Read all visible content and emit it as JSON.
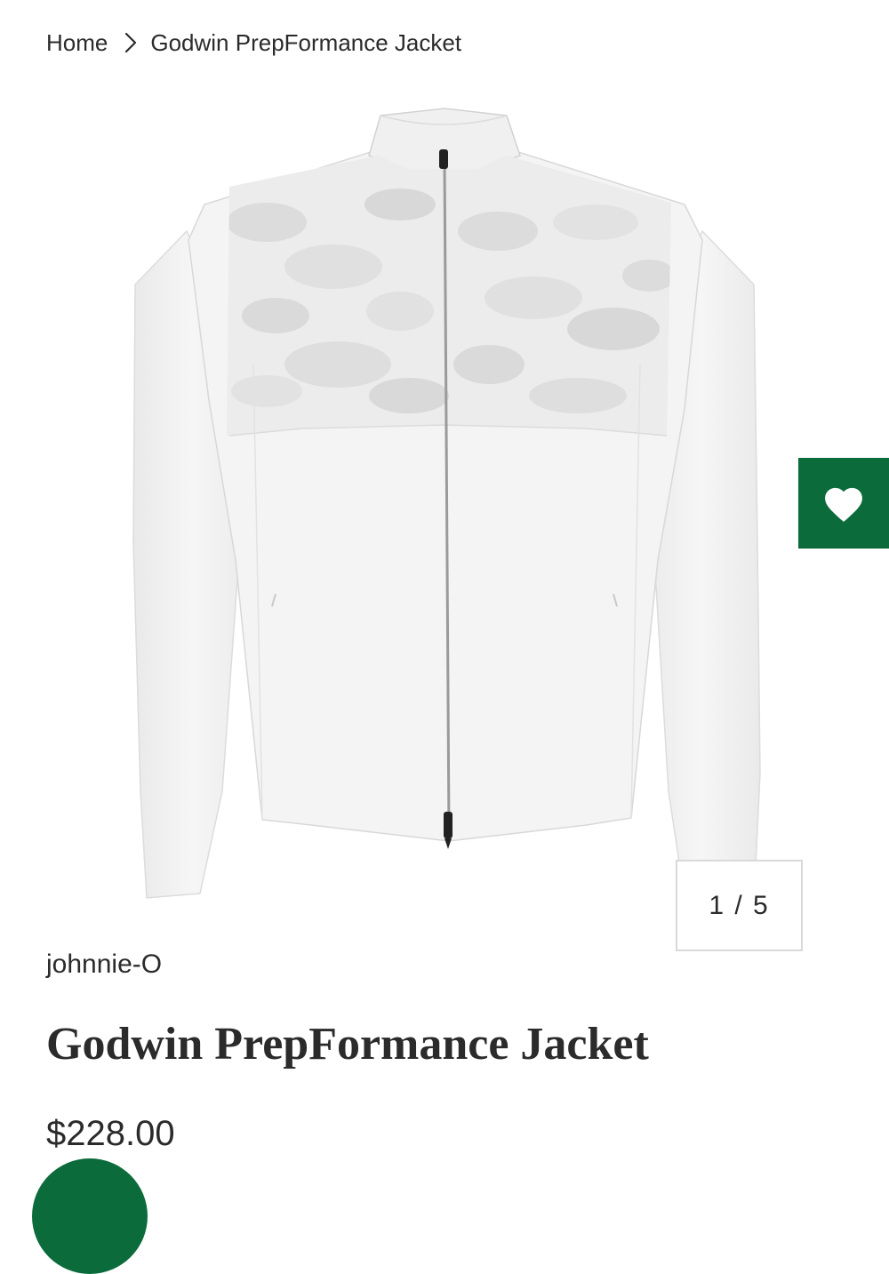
{
  "breadcrumb": {
    "home": "Home",
    "current": "Godwin PrepFormance Jacket"
  },
  "icons": {
    "separator": "chevron-right-icon",
    "wishlist": "heart-icon"
  },
  "gallery": {
    "counter": "1 / 5",
    "current_image": 1,
    "total_images": 5
  },
  "product": {
    "brand": "johnnie-O",
    "name": "Godwin PrepFormance Jacket",
    "price": "$228.00"
  },
  "colors": {
    "accent": "#0b6b3a",
    "text": "#2b2b2b",
    "border": "#d9d9d9",
    "background": "#ffffff"
  }
}
